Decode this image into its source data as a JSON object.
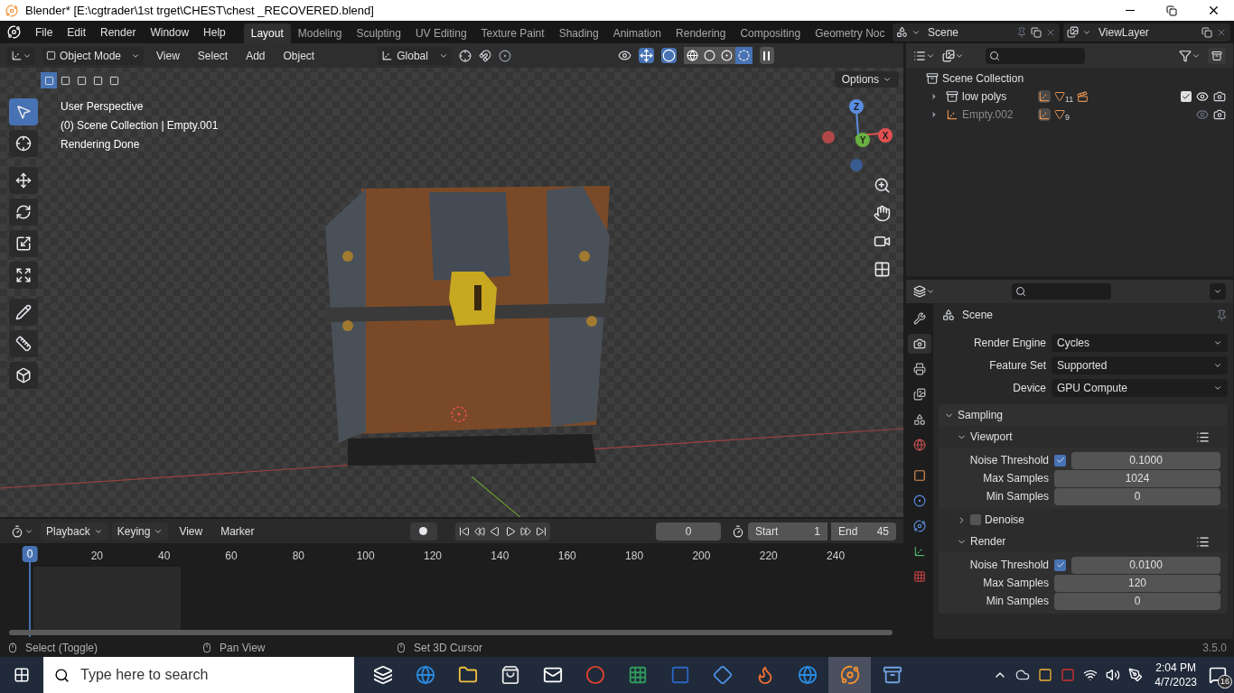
{
  "window": {
    "title": "Blender* [E:\\cgtrader\\1st trget\\CHEST\\chest _RECOVERED.blend]"
  },
  "menu": [
    "File",
    "Edit",
    "Render",
    "Window",
    "Help"
  ],
  "workspaces": [
    {
      "label": "Layout",
      "selected": true
    },
    {
      "label": "Modeling",
      "selected": false
    },
    {
      "label": "Sculpting",
      "selected": false
    },
    {
      "label": "UV Editing",
      "selected": false
    },
    {
      "label": "Texture Paint",
      "selected": false
    },
    {
      "label": "Shading",
      "selected": false
    },
    {
      "label": "Animation",
      "selected": false
    },
    {
      "label": "Rendering",
      "selected": false
    },
    {
      "label": "Compositing",
      "selected": false
    },
    {
      "label": "Geometry Noc",
      "selected": false
    }
  ],
  "scene": "Scene",
  "view_layer": "ViewLayer",
  "viewport": {
    "mode": "Object Mode",
    "menus": [
      "View",
      "Select",
      "Add",
      "Object"
    ],
    "orientation": "Global",
    "options": "Options",
    "select_modes": [
      {
        "selected": true
      },
      {
        "selected": false
      },
      {
        "selected": false
      },
      {
        "selected": false
      },
      {
        "selected": false
      }
    ],
    "shading": [
      {
        "kind": "wire",
        "selected": false
      },
      {
        "kind": "solid",
        "selected": false
      },
      {
        "kind": "material",
        "selected": false
      },
      {
        "kind": "rendered",
        "selected": true
      }
    ],
    "overlay_text": [
      "User Perspective",
      "(0) Scene Collection | Empty.001",
      "Rendering Done"
    ],
    "tools": [
      {
        "kind": "select",
        "selected": true
      },
      {
        "kind": "cursor",
        "selected": false
      },
      {
        "kind": "move",
        "selected": false
      },
      {
        "kind": "rotate",
        "selected": false
      },
      {
        "kind": "scale",
        "selected": false
      },
      {
        "kind": "transform",
        "selected": false
      },
      {
        "kind": "annotate",
        "selected": false
      },
      {
        "kind": "measure",
        "selected": false
      },
      {
        "kind": "add_cube",
        "selected": false
      }
    ],
    "gizmo_axes": [
      "Z",
      "Y",
      "X"
    ]
  },
  "timeline": {
    "menus": [
      "Playback",
      "Keying",
      "View",
      "Marker"
    ],
    "current_frame": "0",
    "start": {
      "label": "Start",
      "value": "1"
    },
    "end": {
      "label": "End",
      "value": "45"
    },
    "playhead": "0",
    "ticks": [
      "20",
      "40",
      "60",
      "80",
      "100",
      "120",
      "140",
      "160",
      "180",
      "200",
      "220",
      "240"
    ]
  },
  "outliner": {
    "items": [
      {
        "label": "Scene Collection",
        "kind": "collection",
        "children": [
          {
            "label": "low polys",
            "kind": "collection",
            "expanded": false,
            "count": "11",
            "checked": true
          },
          {
            "label": "Empty.002",
            "kind": "empty",
            "expanded": false,
            "count": "9"
          }
        ]
      }
    ]
  },
  "properties": {
    "tabs": [
      {
        "kind": "tool",
        "selected": false
      },
      {
        "kind": "render",
        "selected": true
      },
      {
        "kind": "output",
        "selected": false
      },
      {
        "kind": "view_layer",
        "selected": false
      },
      {
        "kind": "scene",
        "selected": false
      },
      {
        "kind": "world",
        "selected": false
      },
      {
        "kind": "object",
        "selected": false
      },
      {
        "kind": "physics",
        "selected": false
      },
      {
        "kind": "constraints",
        "selected": false
      },
      {
        "kind": "data",
        "selected": false
      },
      {
        "kind": "texture",
        "selected": false
      }
    ],
    "title": "Scene",
    "fields": [
      {
        "label": "Render Engine",
        "value": "Cycles"
      },
      {
        "label": "Feature Set",
        "value": "Supported"
      },
      {
        "label": "Device",
        "value": "GPU Compute"
      }
    ],
    "section": {
      "label": "Sampling",
      "expanded": true,
      "subsections": [
        {
          "label": "Viewport",
          "expanded": true,
          "rows": [
            {
              "label": "Noise Threshold",
              "checked": true,
              "value": "0.1000"
            },
            {
              "label": "Max Samples",
              "value": "1024"
            },
            {
              "label": "Min Samples",
              "value": "0"
            }
          ]
        },
        {
          "label": "Denoise",
          "expanded": false,
          "checked": false
        },
        {
          "label": "Render",
          "expanded": true,
          "rows": [
            {
              "label": "Noise Threshold",
              "checked": true,
              "value": "0.0100"
            },
            {
              "label": "Max Samples",
              "value": "120"
            },
            {
              "label": "Min Samples",
              "value": "0"
            }
          ]
        }
      ]
    }
  },
  "status_bar": {
    "hints": [
      "Select (Toggle)",
      "Pan View",
      "Set 3D Cursor"
    ],
    "version": "3.5.0"
  },
  "taskbar": {
    "search_placeholder": "Type here to search",
    "apps": [
      {
        "kind": "task_view",
        "selected": false
      },
      {
        "kind": "edge",
        "selected": false
      },
      {
        "kind": "explorer",
        "selected": false
      },
      {
        "kind": "store",
        "selected": false
      },
      {
        "kind": "mail",
        "selected": false
      },
      {
        "kind": "chrome",
        "selected": false
      },
      {
        "kind": "excel",
        "selected": false
      },
      {
        "kind": "word",
        "selected": false
      },
      {
        "kind": "app",
        "selected": false
      },
      {
        "kind": "firefox",
        "selected": false
      },
      {
        "kind": "edge",
        "selected": false
      },
      {
        "kind": "blender",
        "selected": true
      },
      {
        "kind": "other",
        "selected": false
      }
    ],
    "time": "2:04 PM",
    "date": "4/7/2023",
    "notifications": "16"
  }
}
